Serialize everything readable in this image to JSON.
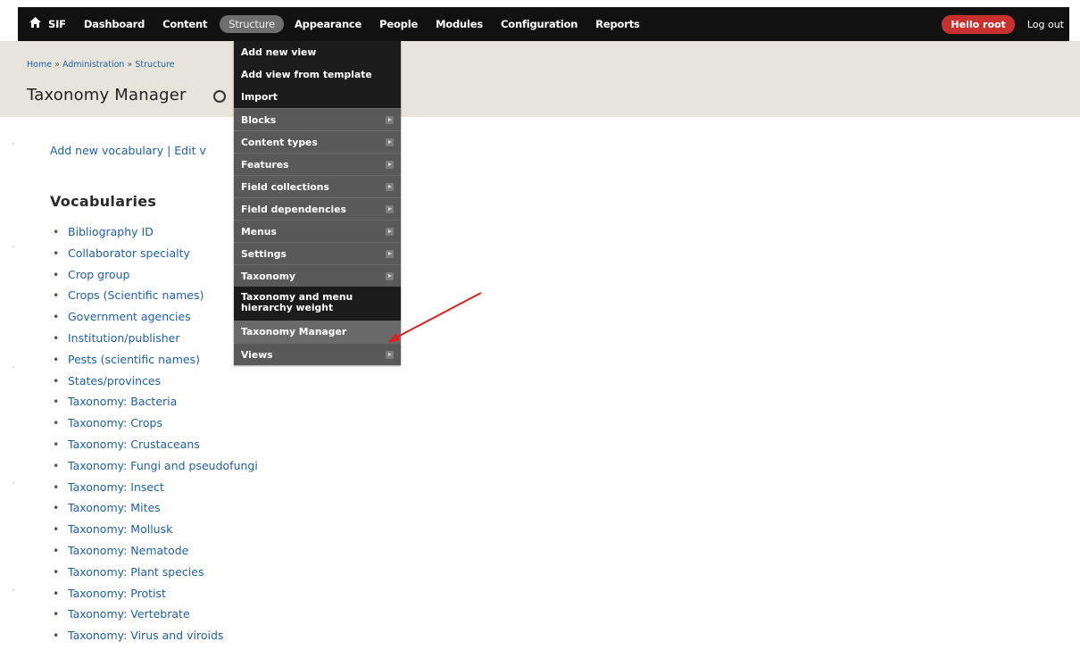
{
  "toolbar": {
    "home_icon": "home-icon",
    "items": [
      "SIF",
      "Dashboard",
      "Content",
      "Structure",
      "Appearance",
      "People",
      "Modules",
      "Configuration",
      "Reports"
    ],
    "active_item": "Structure",
    "user_greeting": "Hello root",
    "logout": "Log out",
    "colors": {
      "background": "#111111",
      "greeting_badge": "#c8312e"
    }
  },
  "breadcrumb": {
    "items": [
      "Home",
      "Administration",
      "Structure"
    ],
    "separator": "»"
  },
  "page_title": "Taxonomy Manager",
  "action_links": {
    "add_vocabulary": "Add new vocabulary",
    "separator": "|",
    "edit_vocabulary": "Edit v"
  },
  "section_title": "Vocabularies",
  "vocabularies": [
    "Bibliography ID",
    "Collaborator specialty",
    "Crop group",
    "Crops (Scientific names)",
    "Government agencies",
    "Institution/publisher",
    "Pests (scientific names)",
    "States/provinces",
    "Taxonomy: Bacteria",
    "Taxonomy: Crops",
    "Taxonomy: Crustaceans",
    "Taxonomy: Fungi and pseudofungi",
    "Taxonomy: Insect",
    "Taxonomy: Mites",
    "Taxonomy: Mollusk",
    "Taxonomy: Nematode",
    "Taxonomy: Plant species",
    "Taxonomy: Protist",
    "Taxonomy: Vertebrate",
    "Taxonomy: Virus and viroids"
  ],
  "dropdown": {
    "items": [
      {
        "label": "Add new view",
        "submenu": false
      },
      {
        "label": "Add view from template",
        "submenu": false
      },
      {
        "label": "Import",
        "submenu": false
      },
      {
        "label": "Blocks",
        "submenu": true
      },
      {
        "label": "Content types",
        "submenu": true
      },
      {
        "label": "Features",
        "submenu": true
      },
      {
        "label": "Field collections",
        "submenu": true
      },
      {
        "label": "Field dependencies",
        "submenu": true
      },
      {
        "label": "Menus",
        "submenu": true
      },
      {
        "label": "Settings",
        "submenu": true
      },
      {
        "label": "Taxonomy",
        "submenu": true
      },
      {
        "label": "Taxonomy and menu hierarchy weight",
        "submenu": false
      },
      {
        "label": "Taxonomy Manager",
        "submenu": false,
        "highlighted": true
      },
      {
        "label": "Views",
        "submenu": true
      }
    ]
  },
  "annotation": {
    "color": "#e02020",
    "icon": "red-arrow-pointer"
  }
}
